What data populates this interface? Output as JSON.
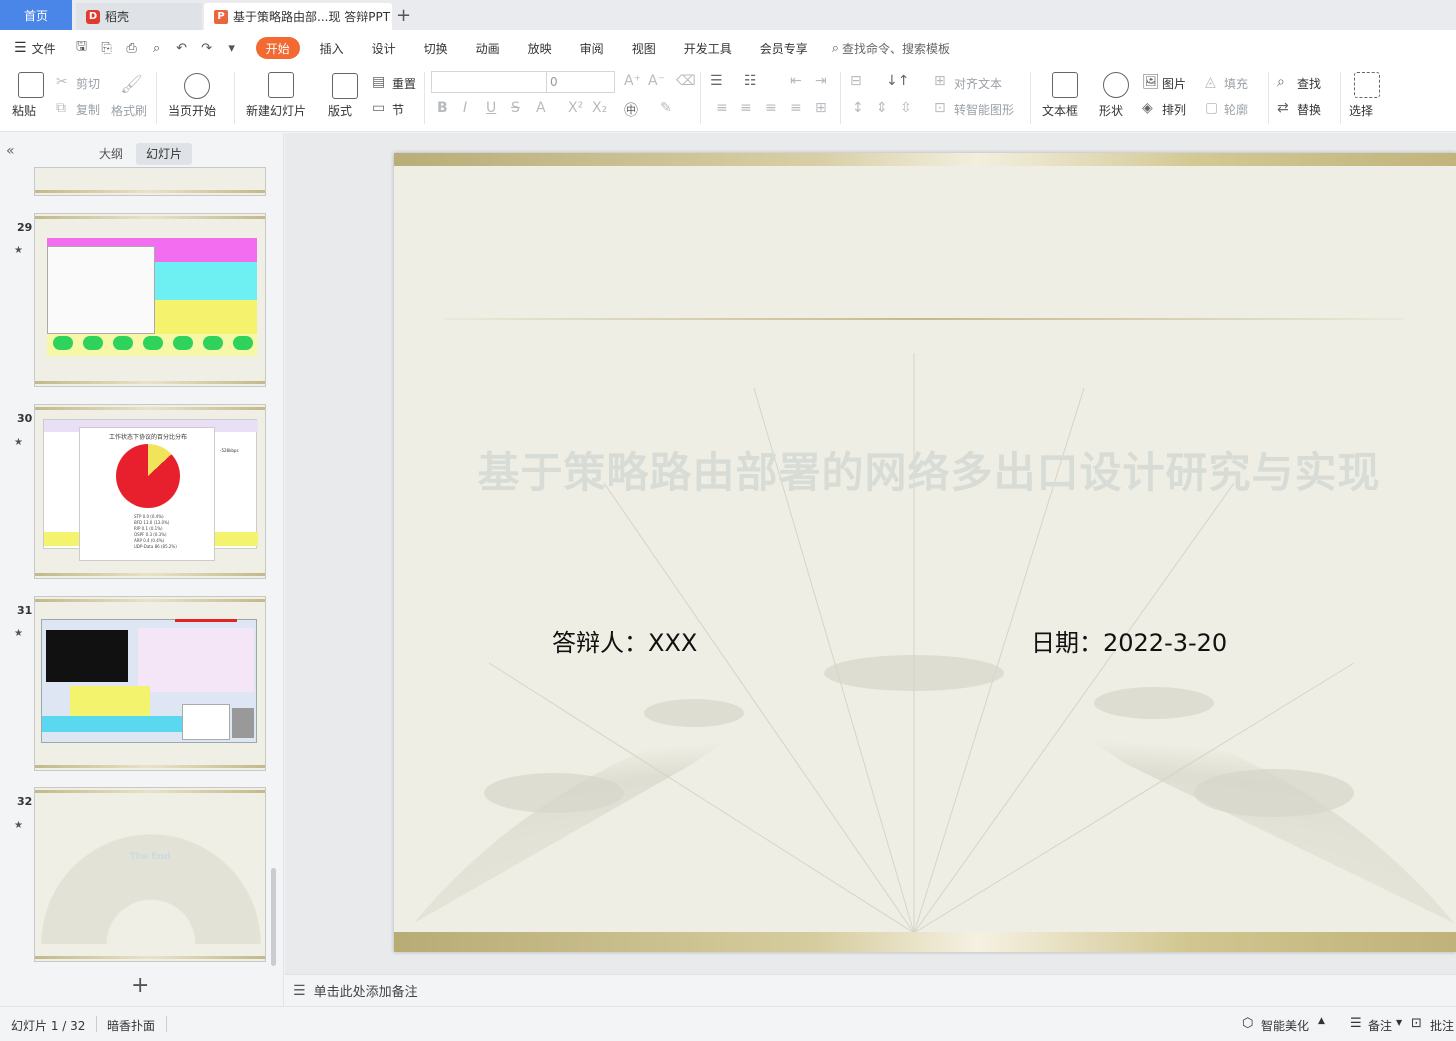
{
  "tabs": {
    "home": "首页",
    "daoke": "稻壳",
    "document": "基于策略路由部...现 答辩PPT",
    "add": "+"
  },
  "menu": {
    "file": "文件",
    "tabs": [
      "开始",
      "插入",
      "设计",
      "切换",
      "动画",
      "放映",
      "审阅",
      "视图",
      "开发工具",
      "会员专享"
    ],
    "search": "查找命令、搜索模板"
  },
  "ribbon": {
    "paste": "粘贴",
    "cut": "剪切",
    "copy": "复制",
    "format_painter": "格式刷",
    "play_current": "当页开始",
    "new_slide": "新建幻灯片",
    "layout": "版式",
    "reset": "重置",
    "section": "节",
    "font_size": "0",
    "align_text": "对齐文本",
    "convert_smartart": "转智能图形",
    "textbox": "文本框",
    "shape": "形状",
    "picture": "图片",
    "arrange": "排列",
    "fill": "填充",
    "outline": "轮廓",
    "find": "查找",
    "replace": "替换",
    "select": "选择"
  },
  "left_panel": {
    "outline_tab": "大纲",
    "slides_tab": "幻灯片",
    "thumbnails": [
      {
        "number": "29"
      },
      {
        "number": "30",
        "chart_title": "工作状态下协议的百分比分布",
        "legend": [
          "STP 0.0 (0.4%)",
          "BFD 13.0 (13.0%)",
          "RIP 0.1 (0.1%)",
          "OSPF 0.3 (0.3%)",
          "ARP 0.4 (0.4%)",
          "UDP-Data 86 (85.2%)"
        ],
        "side_label": "-528kbps"
      },
      {
        "number": "31"
      },
      {
        "number": "32",
        "text": "The End"
      }
    ]
  },
  "slide": {
    "title": "基于策略路由部署的网络多出口设计研究与实现",
    "defender": "答辩人：XXX",
    "date": "日期：2022-3-20"
  },
  "notes": {
    "placeholder": "单击此处添加备注"
  },
  "status": {
    "slide_counter": "幻灯片 1 / 32",
    "theme": "暗香扑面",
    "smart_beautify": "智能美化",
    "notes_btn": "备注",
    "comments_btn": "批注"
  },
  "colors": {
    "accent": "#f26a32",
    "home_tab": "#4a86e8",
    "slide_gold": "#c2b98a"
  }
}
